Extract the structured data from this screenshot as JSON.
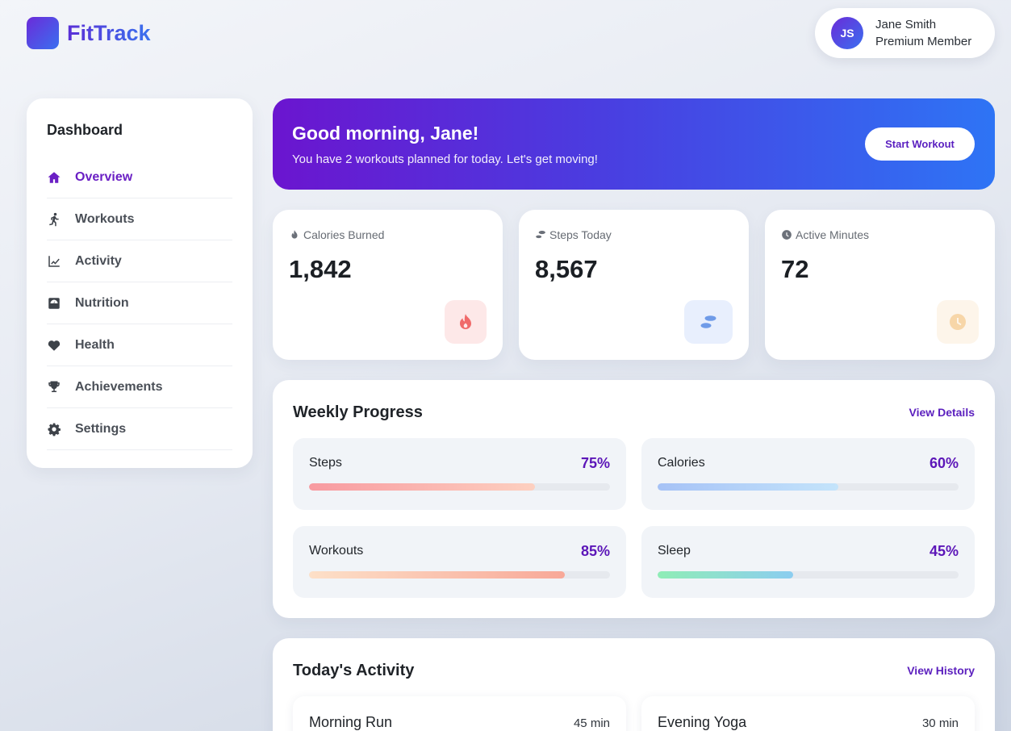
{
  "brand": {
    "name": "FitTrack"
  },
  "user": {
    "initials": "JS",
    "name": "Jane Smith",
    "membership": "Premium Member"
  },
  "sidebar": {
    "title": "Dashboard",
    "items": [
      {
        "label": "Overview",
        "icon": "home-icon",
        "active": true
      },
      {
        "label": "Workouts",
        "icon": "running-icon"
      },
      {
        "label": "Activity",
        "icon": "chart-line-icon"
      },
      {
        "label": "Nutrition",
        "icon": "scale-icon"
      },
      {
        "label": "Health",
        "icon": "heart-icon"
      },
      {
        "label": "Achievements",
        "icon": "trophy-icon"
      },
      {
        "label": "Settings",
        "icon": "gear-icon"
      }
    ]
  },
  "banner": {
    "greeting": "Good morning, Jane!",
    "message": "You have 2 workouts planned for today. Let's get moving!",
    "button": "Start Workout"
  },
  "stats": [
    {
      "label": "Calories Burned",
      "value": "1,842",
      "icon": "fire-icon",
      "color": "#f26b6b",
      "bg": "#fde8e8"
    },
    {
      "label": "Steps Today",
      "value": "8,567",
      "icon": "footprints-icon",
      "color": "#6f9be8",
      "bg": "#e8effd"
    },
    {
      "label": "Active Minutes",
      "value": "72",
      "icon": "clock-icon",
      "color": "#f7d6a8",
      "bg": "#fdf5ea"
    }
  ],
  "weekly": {
    "title": "Weekly Progress",
    "link": "View Details",
    "items": [
      {
        "name": "Steps",
        "pct_text": "75%",
        "pct": 75,
        "from": "#f89aa0",
        "to": "#fdd0c0"
      },
      {
        "name": "Calories",
        "pct_text": "60%",
        "pct": 60,
        "from": "#a6c2f6",
        "to": "#c4e4fb"
      },
      {
        "name": "Workouts",
        "pct_text": "85%",
        "pct": 85,
        "from": "#fde0c8",
        "to": "#f8a898"
      },
      {
        "name": "Sleep",
        "pct_text": "45%",
        "pct": 45,
        "from": "#8fedb6",
        "to": "#8ccdf0"
      }
    ]
  },
  "today": {
    "title": "Today's Activity",
    "link": "View History",
    "items": [
      {
        "name": "Morning Run",
        "duration": "45 min"
      },
      {
        "name": "Evening Yoga",
        "duration": "30 min"
      }
    ]
  }
}
